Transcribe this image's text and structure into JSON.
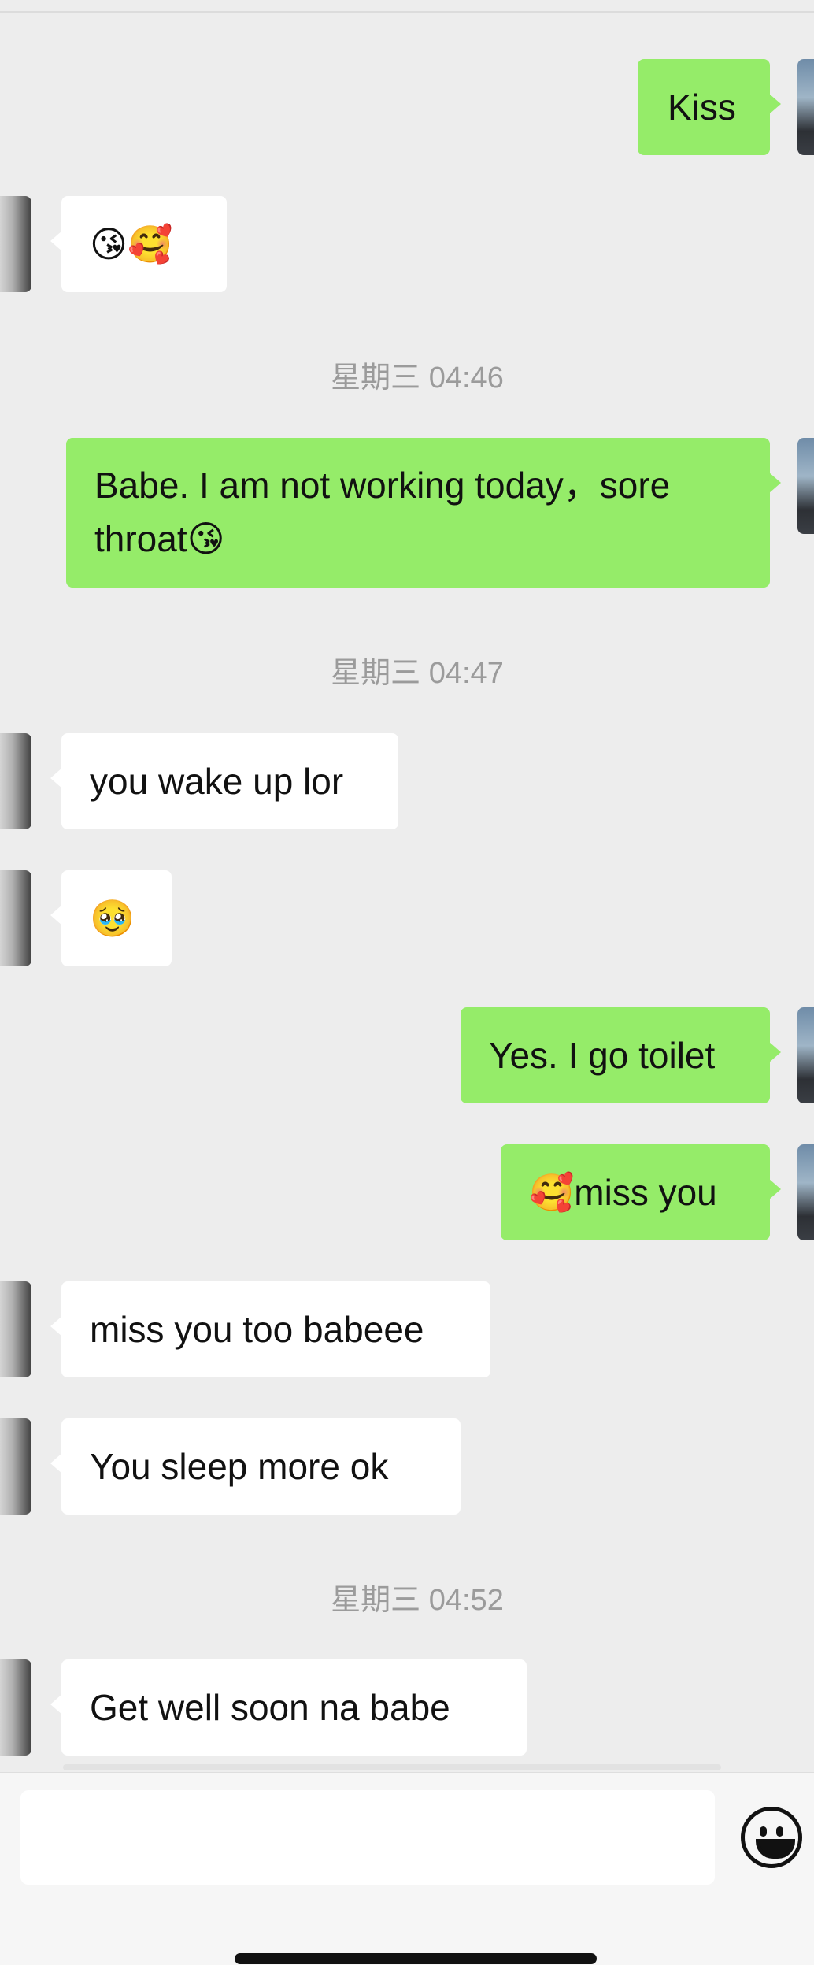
{
  "messages": [
    {
      "id": "m1",
      "side": "mine",
      "text": "Kiss"
    },
    {
      "id": "m2",
      "side": "other",
      "text": "😘🥰"
    },
    {
      "id": "t1",
      "type": "time",
      "text": "星期三 04:46"
    },
    {
      "id": "m3",
      "side": "mine",
      "text": "Babe. I am not working today，sore throat😘"
    },
    {
      "id": "t2",
      "type": "time",
      "text": "星期三 04:47"
    },
    {
      "id": "m4",
      "side": "other",
      "text": "you wake up lor"
    },
    {
      "id": "m5",
      "side": "other",
      "text": "🥹"
    },
    {
      "id": "m6",
      "side": "mine",
      "text": "Yes. I go toilet"
    },
    {
      "id": "m7",
      "side": "mine",
      "text": "🥰miss you"
    },
    {
      "id": "m8",
      "side": "other",
      "text": "miss you too babeee"
    },
    {
      "id": "m9",
      "side": "other",
      "text": "You sleep more ok"
    },
    {
      "id": "t3",
      "type": "time",
      "text": "星期三 04:52"
    },
    {
      "id": "m10",
      "side": "other",
      "text": "Get well soon na babe"
    }
  ],
  "composer": {
    "input_value": "",
    "emoji_button_icon": "smiley-face-icon"
  },
  "colors": {
    "background": "#ededed",
    "mine_bubble": "#95ec69",
    "other_bubble": "#ffffff",
    "timestamp": "#9b9b9b"
  }
}
